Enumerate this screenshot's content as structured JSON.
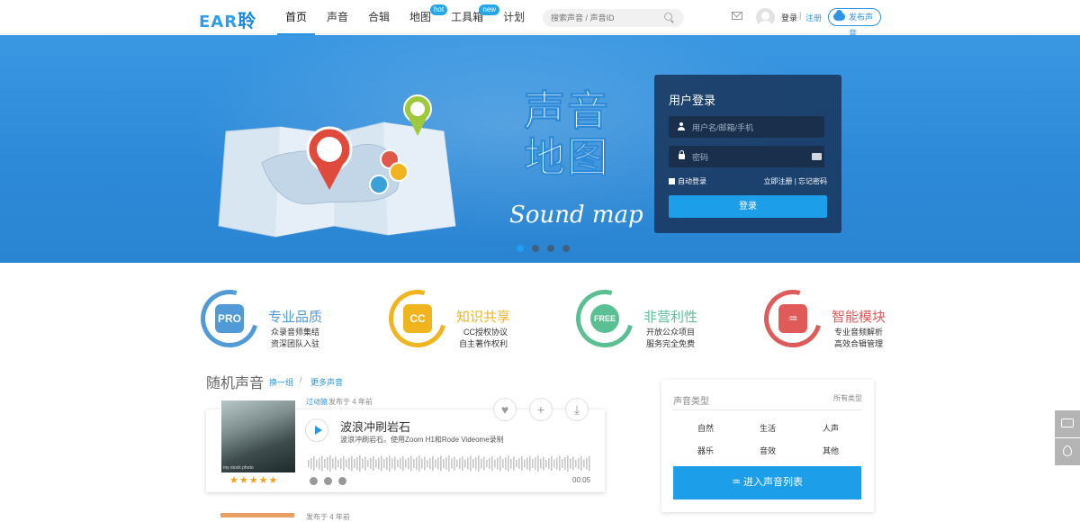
{
  "logo": {
    "text": "EAR",
    "cn": "聆"
  },
  "nav": [
    {
      "label": "首页",
      "badge": ""
    },
    {
      "label": "声音",
      "badge": ""
    },
    {
      "label": "合辑",
      "badge": ""
    },
    {
      "label": "地图",
      "badge": "hot"
    },
    {
      "label": "工具箱",
      "badge": "new"
    },
    {
      "label": "计划",
      "badge": ""
    }
  ],
  "search": {
    "placeholder": "搜索声音 / 声音ID"
  },
  "header": {
    "login": "登录",
    "sep": "|",
    "register": "注册",
    "publish": "发布声音"
  },
  "banner": {
    "title_cn": "声音地图",
    "title_en": "Sound map",
    "dots_count": 4,
    "active_dot": 1
  },
  "login": {
    "title": "用户登录",
    "user_placeholder": "用户名/邮箱/手机",
    "pwd_placeholder": "密码",
    "remember": "自动登录",
    "links": "立即注册 | 忘记密码",
    "button": "登录"
  },
  "features": [
    {
      "badge": "PRO",
      "title": "专业品质",
      "line1": "众录音师集结",
      "line2": "资深团队入驻",
      "color": "#4f9ad7"
    },
    {
      "badge": "CC",
      "title": "知识共享",
      "line1": "CC授权协议",
      "line2": "自主著作权利",
      "color": "#f0b41e"
    },
    {
      "badge": "FREE",
      "title": "非营利性",
      "line1": "开放公众项目",
      "line2": "服务完全免费",
      "color": "#5bbf94"
    },
    {
      "badge": "♒",
      "title": "智能模块",
      "line1": "专业音频解析",
      "line2": "高效合辑管理",
      "color": "#e05a5a"
    }
  ],
  "random": {
    "title": "随机声音",
    "link1": "换一组",
    "sep": "/",
    "link2": "更多声音"
  },
  "sound": {
    "uploader": "过动猿",
    "time": "发布于 4 年前",
    "title": "波浪冲刷岩石",
    "desc": "波浪冲刷岩石。使用Zoom H1和Rode Videome录制",
    "duration": "00:05",
    "thumb_caption": "my stock photo",
    "stars": "★★★★★",
    "rating": 4.5
  },
  "sound2": {
    "time": "发布于 4 年前"
  },
  "panel": {
    "title": "声音类型",
    "all": "所有类型",
    "types": [
      "自然",
      "生活",
      "人声",
      "器乐",
      "音效",
      "其他"
    ],
    "button": "进入声音列表"
  },
  "colors": {
    "accent": "#2b95e2",
    "banner": "#2d8ad8",
    "button": "#1d9ee8"
  }
}
